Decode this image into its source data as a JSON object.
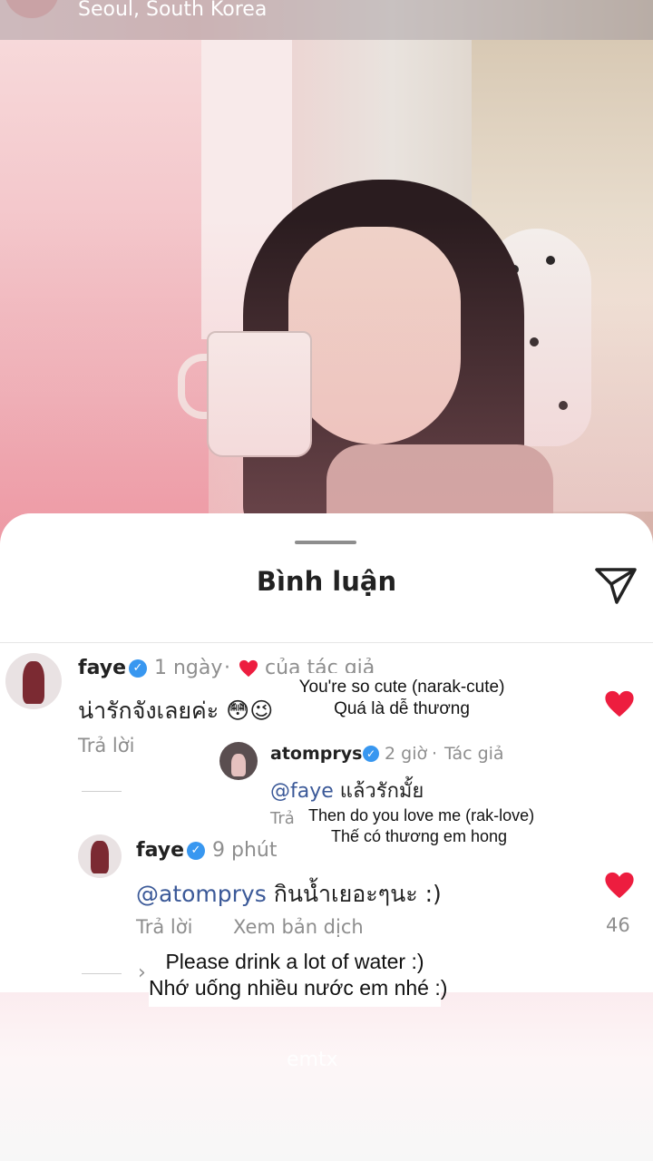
{
  "location": {
    "text": "Seoul, South Korea"
  },
  "sheet": {
    "title": "Bình luận"
  },
  "comments": [
    {
      "user": "faye",
      "time": "1 ngày",
      "meta_suffix": "của tác giả",
      "text": "น่ารักจังเลยค่ะ 😳😉",
      "reply_label": "Trả lời"
    },
    {
      "user": "atomprys",
      "time": "2 giờ",
      "role": "Tác giả",
      "mention": "@faye",
      "text": " แล้วรักมั้ย",
      "reply_label": "Trả"
    },
    {
      "user": "faye",
      "time": "9 phút",
      "mention": "@atomprys",
      "text": " กินน้ำเยอะๆนะ :)",
      "reply_label": "Trả lời",
      "translate_label": "Xem bản dịch",
      "likes": "46"
    }
  ],
  "captions": [
    {
      "line1": "You're so cute (narak-cute)",
      "line2": "Quá là dễ thương"
    },
    {
      "line1": "Then do you love me (rak-love)",
      "line2": "Thế có thương em hong"
    },
    {
      "line1": "Please drink a lot of water :)",
      "line2": "Nhớ uống nhiều nước em nhé :)"
    }
  ],
  "footer": {
    "ghost_text": "emtx"
  },
  "colors": {
    "heart": "#ed1d3f",
    "verified": "#3897f0",
    "mention": "#3b5998"
  },
  "icons": [
    "send-icon",
    "verified-badge-icon",
    "heart-icon",
    "chevron-right-icon"
  ]
}
